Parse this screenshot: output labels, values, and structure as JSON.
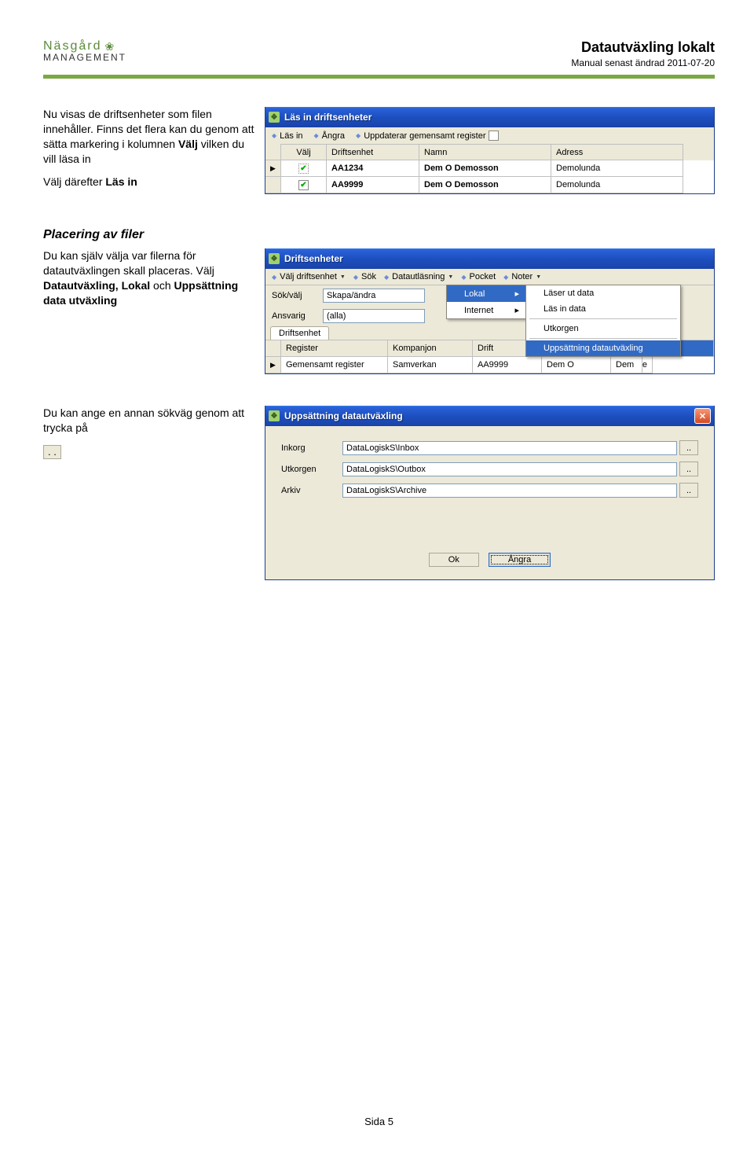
{
  "header": {
    "logo_top": "Näsgård",
    "logo_bottom": "MANAGEMENT",
    "title": "Datautväxling lokalt",
    "subtitle": "Manual senast ändrad 2011-07-20"
  },
  "section1": {
    "p1a": "Nu visas de driftsenheter som filen innehåller. Finns det flera kan du genom att sätta markering i kolumnen ",
    "p1b": "Välj",
    "p1c": " vilken du vill läsa in",
    "p2a": "Välj därefter ",
    "p2b": "Läs in"
  },
  "win1": {
    "title": "Läs in driftsenheter",
    "tb": {
      "lasin": "Läs in",
      "angra": "Ångra",
      "upd": "Uppdaterar gemensamt register"
    },
    "cols": {
      "valj": "Välj",
      "drift": "Driftsenhet",
      "namn": "Namn",
      "adress": "Adress"
    },
    "rows": [
      {
        "drift": "AA1234",
        "namn": "Dem O Demosson",
        "adress": "Demolunda",
        "checked": true
      },
      {
        "drift": "AA9999",
        "namn": "Dem O Demosson",
        "adress": "Demolunda",
        "checked": true
      }
    ]
  },
  "placeringHeading": "Placering av filer",
  "section2": {
    "p1": "Du kan själv välja var filerna för datautväxlingen skall placeras. Välj ",
    "p1b": "Datautväxling, Lokal",
    "p1c": " och ",
    "p1d": "Uppsättning data utväxling"
  },
  "win2": {
    "title": "Driftsenheter",
    "tb1": {
      "valj": "Välj driftsenhet",
      "sok": "Sök",
      "datautl": "Datautläsning",
      "pocket": "Pocket",
      "noter": "Noter"
    },
    "tb2": {
      "sokvalj": "Sök/välj",
      "skapa": "Skapa/ändra",
      "ansvarig": "Ansvarig",
      "alla": "(alla)"
    },
    "menu": {
      "lokal": "Lokal",
      "internet": "Internet",
      "laserut": "Läser ut data",
      "lasin": "Läs in data",
      "utkorgen": "Utkorgen",
      "uppsat": "Uppsättning datautväxling"
    },
    "tabs": {
      "drift": "Driftsenhet"
    },
    "cols": {
      "reg": "Register",
      "komp": "Kompanjon",
      "drift": "Drift"
    },
    "row": {
      "reg": "Gemensamt register",
      "komp": "Samverkan",
      "drift": "AA9999",
      "namn": "Dem O",
      "extra": "Dem",
      "trail": "e"
    }
  },
  "section3": {
    "p1": "Du kan ange en annan sökväg genom att trycka på"
  },
  "win3": {
    "title": "Uppsättning datautväxling",
    "rows": [
      {
        "label": "Inkorg",
        "value": "DataLogiskS\\Inbox"
      },
      {
        "label": "Utkorgen",
        "value": "DataLogiskS\\Outbox"
      },
      {
        "label": "Arkiv",
        "value": "DataLogiskS\\Archive"
      }
    ],
    "ok": "Ok",
    "angra": "Ångra"
  },
  "footer": "Sida 5"
}
